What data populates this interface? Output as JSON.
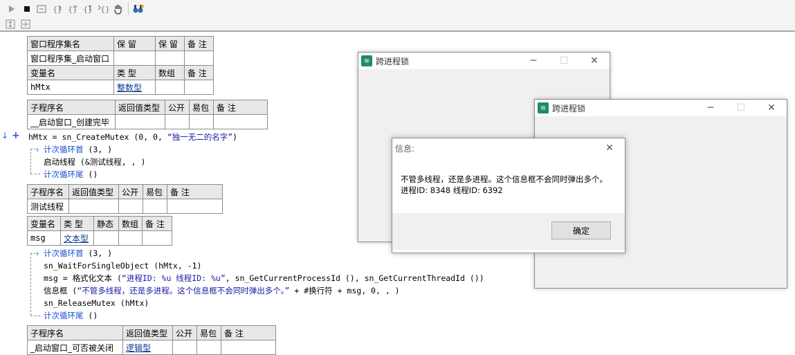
{
  "toolbar": {
    "icons": [
      "play-icon",
      "stop-icon",
      "run-to-cursor-icon",
      "step-into-icon",
      "step-over-icon",
      "step-out-icon",
      "step-back-icon",
      "hand-icon",
      "debug-binoculars-icon"
    ]
  },
  "table_assembly": {
    "headers": [
      "窗口程序集名",
      "保 留",
      "保 留",
      "备 注"
    ],
    "row": [
      "窗口程序集_启动窗口",
      "",
      "",
      ""
    ]
  },
  "table_vars1": {
    "headers": [
      "变量名",
      "类 型",
      "数组",
      "备 注"
    ],
    "row": [
      "hMtx",
      "整数型",
      "",
      ""
    ]
  },
  "table_sub1": {
    "headers": [
      "子程序名",
      "返回值类型",
      "公开",
      "易包",
      "备 注"
    ],
    "row": [
      "__启动窗口_创建完毕",
      "",
      "",
      "",
      ""
    ]
  },
  "code1": {
    "line1_var": "hMtx",
    "line1_eq": " = ",
    "line1_fn": "sn_CreateMutex",
    "line1_args": " (0, 0, ",
    "line1_str": "“独一无二的名字”",
    "line1_end": ")",
    "line2_kw": "计次循环首",
    "line2_args": " (3, )",
    "line3_fn": "启动线程",
    "line3_args": " (&测试线程, , )",
    "line4_kw": "计次循环尾",
    "line4_args": " ()"
  },
  "table_sub2": {
    "headers": [
      "子程序名",
      "返回值类型",
      "公开",
      "易包",
      "备 注"
    ],
    "row": [
      "测试线程",
      "",
      "",
      "",
      ""
    ]
  },
  "table_vars2": {
    "headers": [
      "变量名",
      "类 型",
      "静态",
      "数组",
      "备 注"
    ],
    "row": [
      "msg",
      "文本型",
      "",
      "",
      ""
    ]
  },
  "code2": {
    "line1_kw": "计次循环首",
    "line1_args": " (3, )",
    "line2": "sn_WaitForSingleObject (hMtx, -1)",
    "line3_var": "msg",
    "line3_eq": " = ",
    "line3_fn": "格式化文本",
    "line3_open": " (",
    "line3_str": "“进程ID: %u 线程ID: %u”",
    "line3_rest": ", sn_GetCurrentProcessId (), sn_GetCurrentThreadId ())",
    "line4_fn": "信息框",
    "line4_open": " (",
    "line4_str": "“不管多线程，还是多进程。这个信息框不会同时弹出多个。”",
    "line4_rest": " + #换行符 + msg, 0, , )",
    "line5": "sn_ReleaseMutex (hMtx)",
    "line6_kw": "计次循环尾",
    "line6_args": " ()"
  },
  "table_sub3": {
    "headers": [
      "子程序名",
      "返回值类型",
      "公开",
      "易包",
      "备 注"
    ],
    "row": [
      "_启动窗口_可否被关闭",
      "逻辑型",
      "",
      "",
      ""
    ]
  },
  "window1": {
    "title": "跨进程锁"
  },
  "window2": {
    "title": "跨进程锁"
  },
  "msgbox": {
    "title": "信息:",
    "line1": "不管多线程，还是多进程。这个信息框不会同时弹出多个。",
    "line2": "进程ID: 8348 线程ID: 6392",
    "ok_label": "确定"
  }
}
